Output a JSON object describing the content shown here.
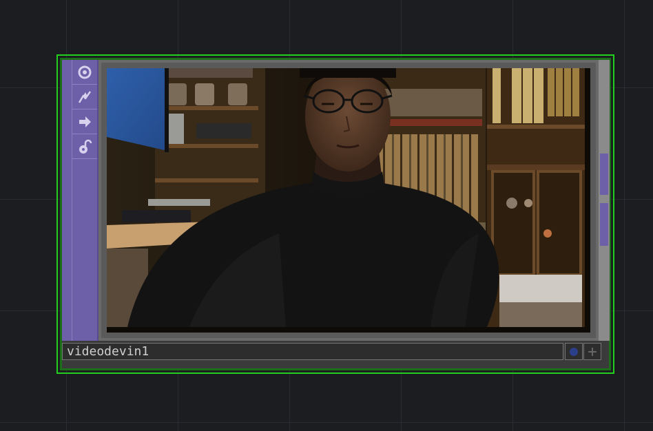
{
  "node": {
    "name": "videodevin1",
    "type_color": "#6d5fa8",
    "selected_outline_color": "#22d11e",
    "icons": [
      "viewer-active-icon",
      "cook-icon",
      "bypass-arrow-icon",
      "lock-icon"
    ],
    "flags": [
      "display-flag-icon",
      "add-icon"
    ]
  },
  "viewer": {
    "content": "webcam-video-feed"
  },
  "colors": {
    "background": "#1c1d20",
    "grid": "#2a2c31",
    "panel": "#3a3a3a"
  }
}
